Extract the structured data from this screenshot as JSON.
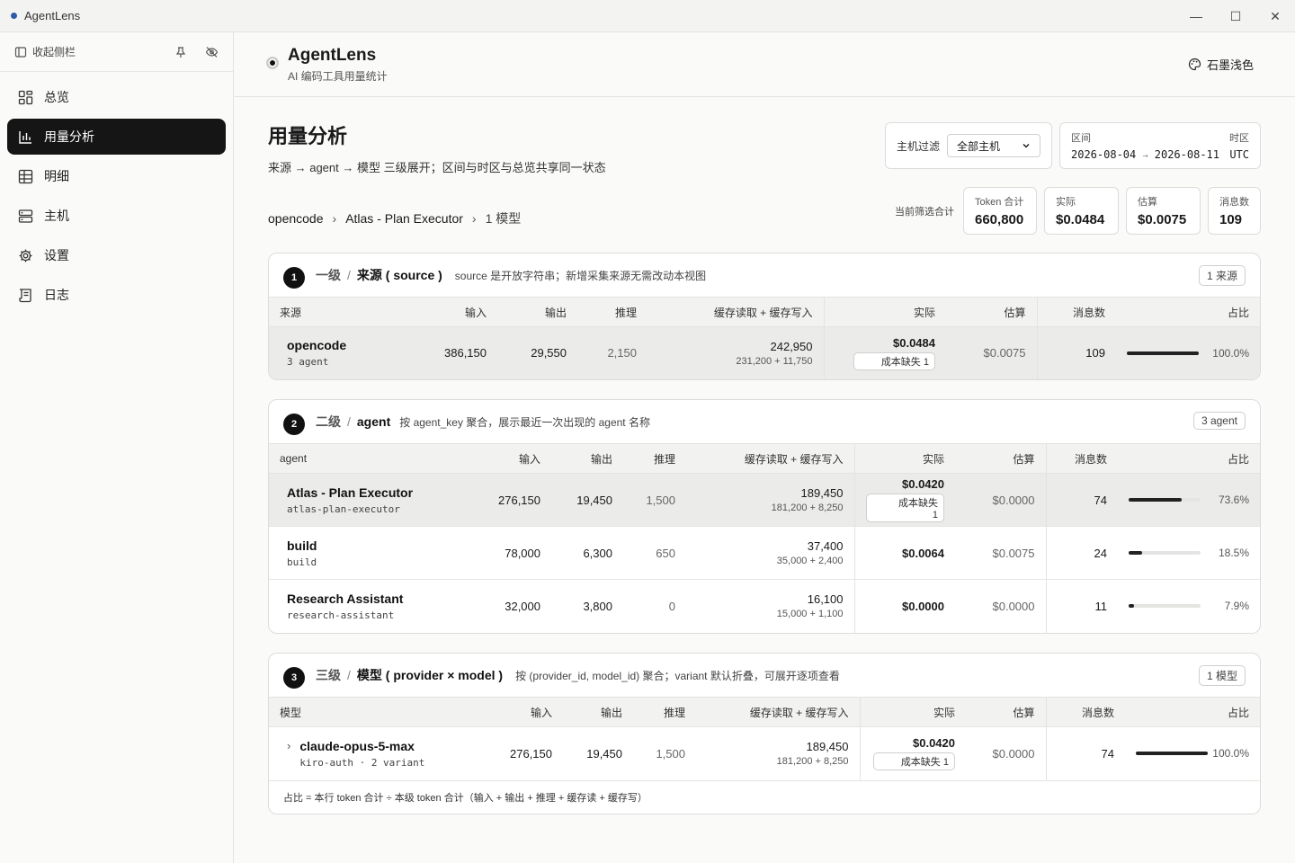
{
  "window": {
    "title": "AgentLens",
    "minimize": "—",
    "maximize": "☐",
    "close": "✕"
  },
  "sidebar": {
    "collapse_label": "收起侧栏",
    "items": [
      {
        "label": "总览",
        "icon": "dashboard-icon"
      },
      {
        "label": "用量分析",
        "icon": "bar-chart-icon",
        "active": true
      },
      {
        "label": "明细",
        "icon": "table-icon"
      },
      {
        "label": "主机",
        "icon": "server-icon"
      },
      {
        "label": "设置",
        "icon": "gear-icon"
      },
      {
        "label": "日志",
        "icon": "log-icon"
      }
    ]
  },
  "header": {
    "app_name": "AgentLens",
    "app_sub": "AI 编码工具用量统计",
    "theme_label": "石墨浅色"
  },
  "page": {
    "title": "用量分析",
    "subtitle": "来源 → agent → 模型 三级展开；区间与时区与总览共享同一状态"
  },
  "filters": {
    "host_label": "主机过滤",
    "host_value": "全部主机",
    "range_label": "区间",
    "tz_label": "时区",
    "range_start": "2026-08-04",
    "range_arrow": "→",
    "range_end": "2026-08-11",
    "tz_value": "UTC"
  },
  "breadcrumb": {
    "source": "opencode",
    "agent": "Atlas - Plan Executor",
    "models": "1 模型"
  },
  "totals": {
    "label": "当前筛选合计",
    "cards": [
      {
        "k": "Token 合计",
        "v": "660,800"
      },
      {
        "k": "实际",
        "v": "$0.0484"
      },
      {
        "k": "估算",
        "v": "$0.0075"
      },
      {
        "k": "消息数",
        "v": "109"
      }
    ]
  },
  "level1": {
    "num": "1",
    "level": "一级",
    "name": "来源 ( source )",
    "desc": "source 是开放字符串；新增采集来源无需改动本视图",
    "tag": "1 来源",
    "headers": {
      "name": "来源",
      "input": "输入",
      "output": "输出",
      "reason": "推理",
      "cache": "缓存读取 + 缓存写入",
      "actual": "实际",
      "est": "估算",
      "msgs": "消息数",
      "share": "占比"
    },
    "rows": [
      {
        "name": "opencode",
        "key": "3 agent",
        "input": "386,150",
        "output": "29,550",
        "reason": "2,150",
        "cache": "242,950",
        "cache_detail": "231,200 + 11,750",
        "actual": "$0.0484",
        "missing": "成本缺失 1",
        "est": "$0.0075",
        "msgs": "109",
        "share": 1.0,
        "share_label": "100.0%"
      }
    ]
  },
  "level2": {
    "num": "2",
    "level": "二级",
    "name": "agent",
    "desc": "按 agent_key 聚合，展示最近一次出现的 agent 名称",
    "tag": "3 agent",
    "headers": {
      "name": "agent",
      "input": "输入",
      "output": "输出",
      "reason": "推理",
      "cache": "缓存读取 + 缓存写入",
      "actual": "实际",
      "est": "估算",
      "msgs": "消息数",
      "share": "占比"
    },
    "rows": [
      {
        "name": "Atlas - Plan Executor",
        "key": "atlas-plan-executor",
        "input": "276,150",
        "output": "19,450",
        "reason": "1,500",
        "cache": "189,450",
        "cache_detail": "181,200 + 8,250",
        "actual": "$0.0420",
        "missing": "成本缺失 1",
        "est": "$0.0000",
        "msgs": "74",
        "share": 0.736,
        "share_label": "73.6%"
      },
      {
        "name": "build",
        "key": "build",
        "input": "78,000",
        "output": "6,300",
        "reason": "650",
        "cache": "37,400",
        "cache_detail": "35,000 + 2,400",
        "actual": "$0.0064",
        "missing": "",
        "est": "$0.0075",
        "msgs": "24",
        "share": 0.185,
        "share_label": "18.5%"
      },
      {
        "name": "Research Assistant",
        "key": "research-assistant",
        "input": "32,000",
        "output": "3,800",
        "reason": "0",
        "cache": "16,100",
        "cache_detail": "15,000 + 1,100",
        "actual": "$0.0000",
        "missing": "",
        "est": "$0.0000",
        "msgs": "11",
        "share": 0.079,
        "share_label": "7.9%"
      }
    ]
  },
  "level3": {
    "num": "3",
    "level": "三级",
    "name": "模型 ( provider × model )",
    "desc": "按 (provider_id, model_id) 聚合；variant 默认折叠，可展开逐项查看",
    "tag": "1 模型",
    "headers": {
      "name": "模型",
      "input": "输入",
      "output": "输出",
      "reason": "推理",
      "cache": "缓存读取 + 缓存写入",
      "actual": "实际",
      "est": "估算",
      "msgs": "消息数",
      "share": "占比"
    },
    "rows": [
      {
        "name": "claude-opus-5-max",
        "key": "kiro-auth · 2 variant",
        "input": "276,150",
        "output": "19,450",
        "reason": "1,500",
        "cache": "189,450",
        "cache_detail": "181,200 + 8,250",
        "actual": "$0.0420",
        "missing": "成本缺失 1",
        "est": "$0.0000",
        "msgs": "74",
        "share": 1.0,
        "share_label": "100.0%"
      }
    ],
    "footnote": "占比 = 本行 token 合计 ÷ 本级 token 合计（输入 + 输出 + 推理 + 缓存读 + 缓存写）"
  }
}
